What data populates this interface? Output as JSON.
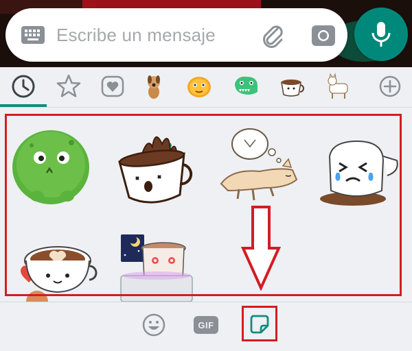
{
  "composer": {
    "placeholder": "Escribe un mensaje",
    "keyboard_icon": "keyboard-icon",
    "attach_icon": "paperclip-icon",
    "camera_icon": "camera-icon",
    "mic_icon": "mic-icon"
  },
  "sticker_tabs": [
    {
      "name": "recent",
      "icon": "clock-icon",
      "selected": true
    },
    {
      "name": "favorites",
      "icon": "star-icon"
    },
    {
      "name": "loved",
      "icon": "heart-icon"
    },
    {
      "name": "pack-dog",
      "icon": "dog-sticker-icon",
      "new": true
    },
    {
      "name": "pack-orange-blob",
      "icon": "orange-blob-sticker-icon"
    },
    {
      "name": "pack-green-dino",
      "icon": "green-dino-sticker-icon"
    },
    {
      "name": "pack-coffee",
      "icon": "coffee-sticker-icon"
    },
    {
      "name": "pack-shiba",
      "icon": "shiba-sticker-icon"
    },
    {
      "name": "add",
      "icon": "plus-icon"
    }
  ],
  "stickers": [
    "green-blob-sticker",
    "spilled-coffee-cup-sticker",
    "sleeping-dog-sticker",
    "crying-cup-sticker",
    "latte-heart-sticker",
    "tired-coffee-laptop-sticker"
  ],
  "bottom_bar": {
    "emoji_icon": "emoji-icon",
    "gif_label": "GIF",
    "sticker_icon": "sticker-icon"
  },
  "colors": {
    "accent": "#00897b",
    "tab_underline": "#128c7e",
    "highlight": "#d31c24"
  }
}
